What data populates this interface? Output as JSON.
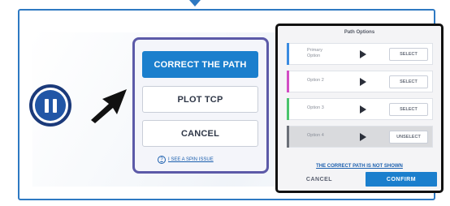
{
  "menu": {
    "correct_label": "CORRECT THE PATH",
    "plot_label": "PLOT TCP",
    "cancel_label": "CANCEL",
    "help_link": "I SEE A SPIN ISSUE"
  },
  "panel": {
    "title": "Path Options",
    "options": [
      {
        "label": "Primary Option",
        "button": "SELECT",
        "color": "#3a8be0",
        "selected": false
      },
      {
        "label": "Option 2",
        "button": "SELECT",
        "color": "#d24cc4",
        "selected": false
      },
      {
        "label": "Option 3",
        "button": "SELECT",
        "color": "#49c46c",
        "selected": false
      },
      {
        "label": "Option 4",
        "button": "UNSELECT",
        "color": "#6b6f78",
        "selected": true
      }
    ],
    "not_shown_link": "THE CORRECT PATH IS NOT SHOWN",
    "cancel_label": "CANCEL",
    "confirm_label": "CONFIRM"
  },
  "colors": {
    "frame": "#2e79c2",
    "primary": "#1b7fcd",
    "menu_border": "#5c5aa8",
    "pause": "#2156a6"
  },
  "icons": [
    "pause-icon",
    "cursor-arrow-icon",
    "help-icon",
    "play-icon"
  ]
}
